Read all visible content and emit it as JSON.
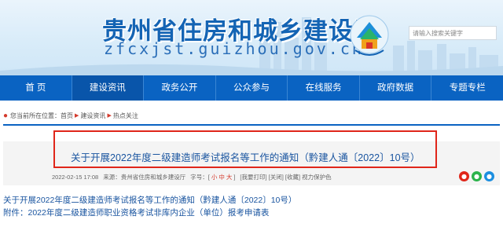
{
  "header": {
    "title": "贵州省住房和城乡建设厅",
    "domain": "zfcxjst.guizhou.gov.cn",
    "search_placeholder": "请输入搜索关键字"
  },
  "nav": {
    "items": [
      "首 页",
      "建设资讯",
      "政务公开",
      "公众参与",
      "在线服务",
      "政府数据",
      "专题专栏"
    ],
    "active_index": 1
  },
  "breadcrumb": {
    "prefix": "您当前所在位置：",
    "items": [
      "首页",
      "建设资讯",
      "热点关注"
    ]
  },
  "article": {
    "title": "关于开展2022年度二级建造师考试报名等工作的通知（黔建人通〔2022〕10号）",
    "date": "2022-02-15 17:08",
    "source": "来源：贵州省住房和城乡建设厅",
    "font_label": "字号：[",
    "font_small": "小",
    "font_medium": "中",
    "font_large": "大",
    "font_close": "]",
    "actions": "[我要打印] [关闭] [收藏] 视力保护色",
    "share_icons": [
      "weibo-icon",
      "wechat-icon",
      "qq-icon"
    ]
  },
  "links": [
    "关于开展2022年度二级建造师考试报名等工作的通知（黔建人通〔2022〕10号）",
    "附件：2022年度二级建造师职业资格考试非库内企业（单位）报考申请表"
  ],
  "colors": {
    "brand_blue": "#0a63c2",
    "highlight_red": "#e0261a",
    "link_blue": "#1a55a0"
  }
}
